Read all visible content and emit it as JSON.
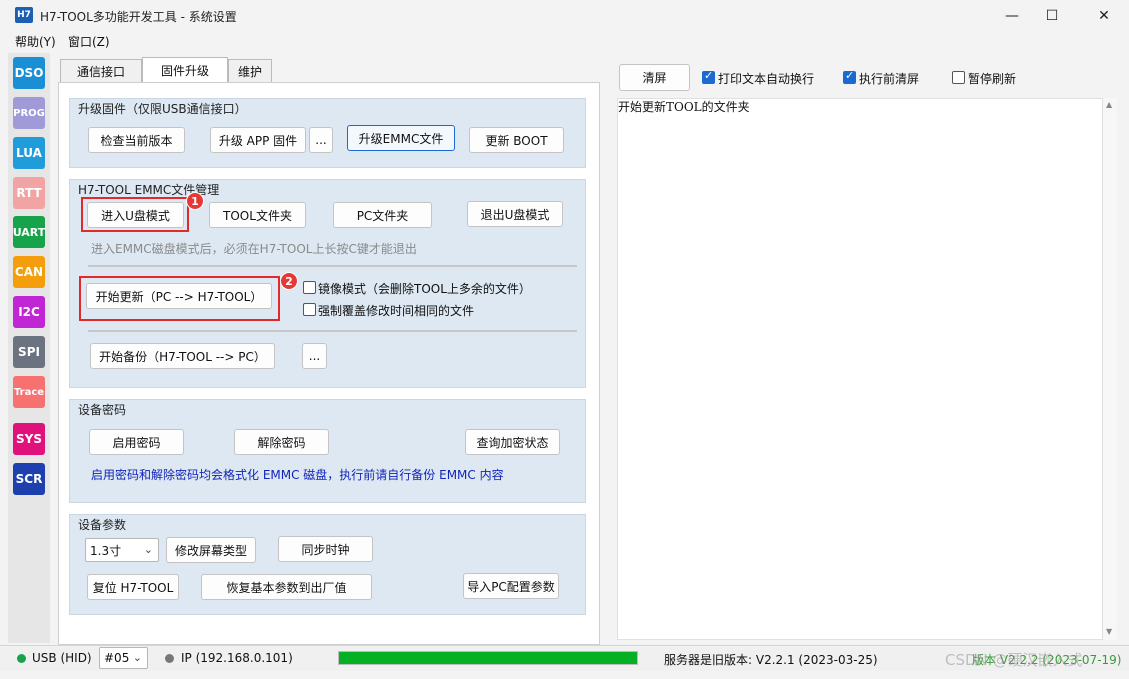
{
  "window": {
    "icon_label": "H7",
    "title": "H7-TOOL多功能开发工具 - 系统设置",
    "minimize": "—",
    "maximize": "☐",
    "close": "✕"
  },
  "menu": [
    "帮助(Y)",
    "窗口(Z)"
  ],
  "sidebar": [
    {
      "label": "DSO",
      "color": "#1a8fd6"
    },
    {
      "label": "PROG",
      "color": "#a09bd8"
    },
    {
      "label": "LUA",
      "color": "#1f9cd9"
    },
    {
      "label": "RTT",
      "color": "#f2a3a3"
    },
    {
      "label": "UART",
      "color": "#16a34a"
    },
    {
      "label": "CAN",
      "color": "#f59e0b"
    },
    {
      "label": "I2C",
      "color": "#c026d3"
    },
    {
      "label": "SPI",
      "color": "#6b7280"
    },
    {
      "label": "Trace",
      "color": "#f87171"
    },
    {
      "label": "SYS",
      "color": "#e0117a"
    },
    {
      "label": "SCR",
      "color": "#1e40af"
    }
  ],
  "tabs": [
    "通信接口",
    "固件升级",
    "维护"
  ],
  "upgrade_group": {
    "title": "升级固件（仅限USB通信接口）",
    "check_version": "检查当前版本",
    "upgrade_app": "升级 APP 固件",
    "more": "...",
    "upgrade_emmc": "升级EMMC文件",
    "update_boot": "更新 BOOT"
  },
  "emmc_group": {
    "title": "H7-TOOL EMMC文件管理",
    "enter_udisk": "进入U盘模式",
    "tool_folder": "TOOL文件夹",
    "pc_folder": "PC文件夹",
    "exit_udisk": "退出U盘模式",
    "hint": "进入EMMC磁盘模式后，必须在H7-TOOL上长按C键才能退出",
    "start_update": "开始更新（PC --> H7-TOOL）",
    "mirror_mode": "镜像模式（会删除TOOL上多余的文件）",
    "force_overwrite": "强制覆盖修改时间相同的文件",
    "start_backup": "开始备份（H7-TOOL --> PC）",
    "more": "...",
    "badge1": "1",
    "badge2": "2"
  },
  "password_group": {
    "title": "设备密码",
    "enable": "启用密码",
    "disable": "解除密码",
    "query": "查询加密状态",
    "note": "启用密码和解除密码均会格式化 EMMC 磁盘，执行前请自行备份 EMMC 内容"
  },
  "params_group": {
    "title": "设备参数",
    "screen_size": "1.3寸",
    "modify_screen": "修改屏幕类型",
    "sync_clock": "同步时钟",
    "reset": "复位 H7-TOOL",
    "restore_factory": "恢复基本参数到出厂值",
    "import_pc": "导入PC配置参数"
  },
  "log_panel": {
    "clear": "清屏",
    "auto_wrap": "打印文本自动换行",
    "clear_before": "执行前清屏",
    "pause_refresh": "暂停刷新",
    "auto_wrap_checked": true,
    "clear_before_checked": true,
    "pause_refresh_checked": false,
    "text": "开始更新TOOL的文件夹"
  },
  "status": {
    "usb": "USB (HID)",
    "port": "#05",
    "ip": "IP (192.168.0.101)",
    "progress": 1.0,
    "server": "服务器是旧版本: V2.2.1 (2023-03-25)",
    "version": "版本 V2.2.2 (2023-07-19)",
    "watermark": "CSDN @硬汉嵌入式"
  }
}
